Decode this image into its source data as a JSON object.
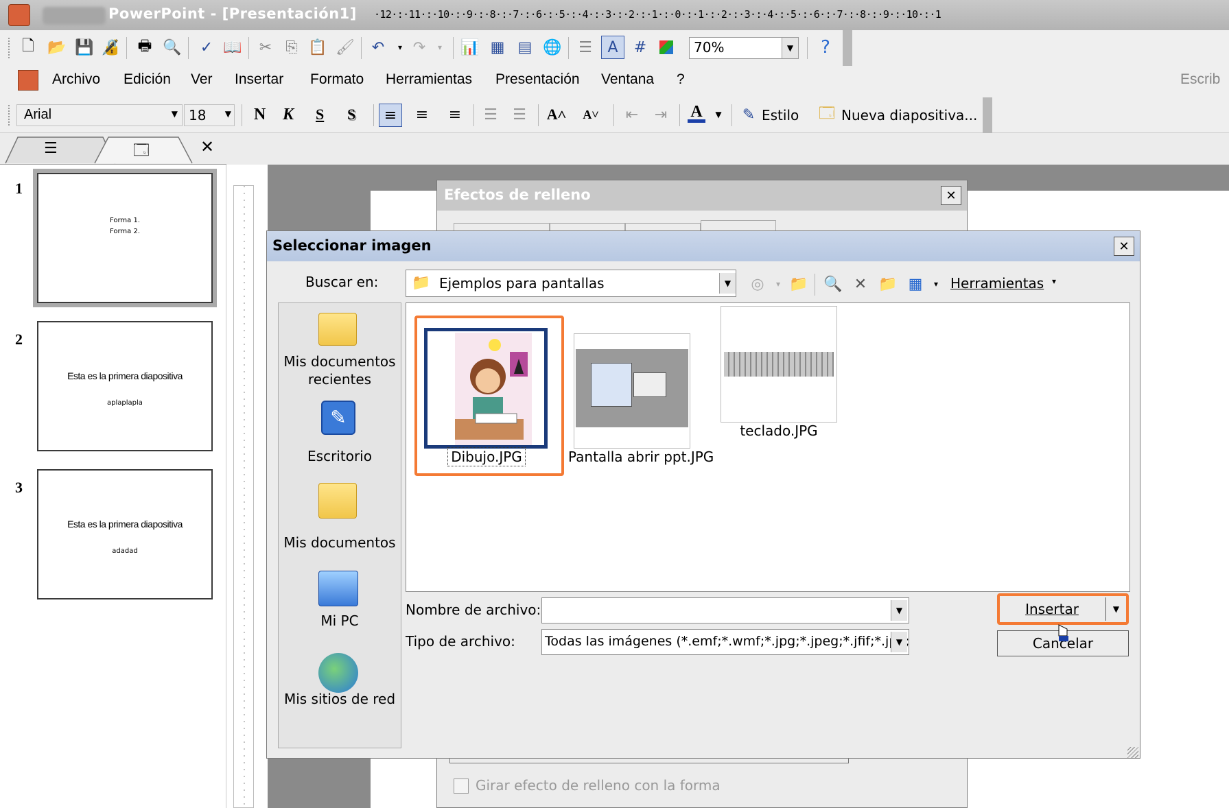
{
  "app": {
    "title": "PowerPoint - [Presentación1]"
  },
  "toolbar": {
    "zoom": "70%"
  },
  "menubar": {
    "items": [
      "Archivo",
      "Edición",
      "Ver",
      "Insertar",
      "Formato",
      "Herramientas",
      "Presentación",
      "Ventana",
      "?"
    ],
    "help_placeholder": "Escrib"
  },
  "format_toolbar": {
    "font": "Arial",
    "size": "18",
    "bold": "N",
    "italic": "K",
    "underline": "S",
    "shadow": "S",
    "font_color_glyph": "A",
    "style_label": "Estilo",
    "new_slide_label": "Nueva diapositiva..."
  },
  "ruler": {
    "horizontal": "·12·:·11·:·10·:·9·:·8·:·7·:·6·:·5·:·4·:·3·:·2·:·1·:·0·:·1·:·2·:·3·:·4·:·5·:·6·:·7·:·8·:·9·:·10·:·1"
  },
  "slides_panel": {
    "close_glyph": "✕",
    "slides": [
      {
        "number": "1",
        "line1": "Forma 1.",
        "line2": "Forma 2."
      },
      {
        "number": "2",
        "line1": "Esta es la primera diapositiva",
        "line2": "aplaplapla"
      },
      {
        "number": "3",
        "line1": "Esta es la primera diapositiva",
        "line2": "adadad"
      }
    ]
  },
  "fill_effects_dialog": {
    "title": "Efectos de relleno",
    "rotate_checkbox_label": "Girar efecto de relleno con la forma"
  },
  "select_image_dialog": {
    "title": "Seleccionar imagen",
    "look_in_label": "Buscar en:",
    "look_in_value": "Ejemplos para pantallas",
    "tools_label": "Herramientas",
    "places": [
      {
        "label": "Mis documentos recientes"
      },
      {
        "label": "Escritorio"
      },
      {
        "label": "Mis documentos"
      },
      {
        "label": "Mi PC"
      },
      {
        "label": "Mis sitios de red"
      }
    ],
    "files": [
      {
        "name": "Dibujo.JPG"
      },
      {
        "name": "Pantalla abrir ppt.JPG"
      },
      {
        "name": "teclado.JPG"
      }
    ],
    "filename_label": "Nombre de archivo:",
    "filename_value": "",
    "filetype_label": "Tipo de archivo:",
    "filetype_value": "Todas las imágenes (*.emf;*.wmf;*.jpg;*.jpeg;*.jfif;*.jpe;*",
    "insert_button": "Insertar",
    "cancel_button": "Cancelar"
  },
  "colors": {
    "highlight": "#f47a34",
    "title_inactive": "#c8c8c8",
    "title_active": "#b7c8e2"
  }
}
